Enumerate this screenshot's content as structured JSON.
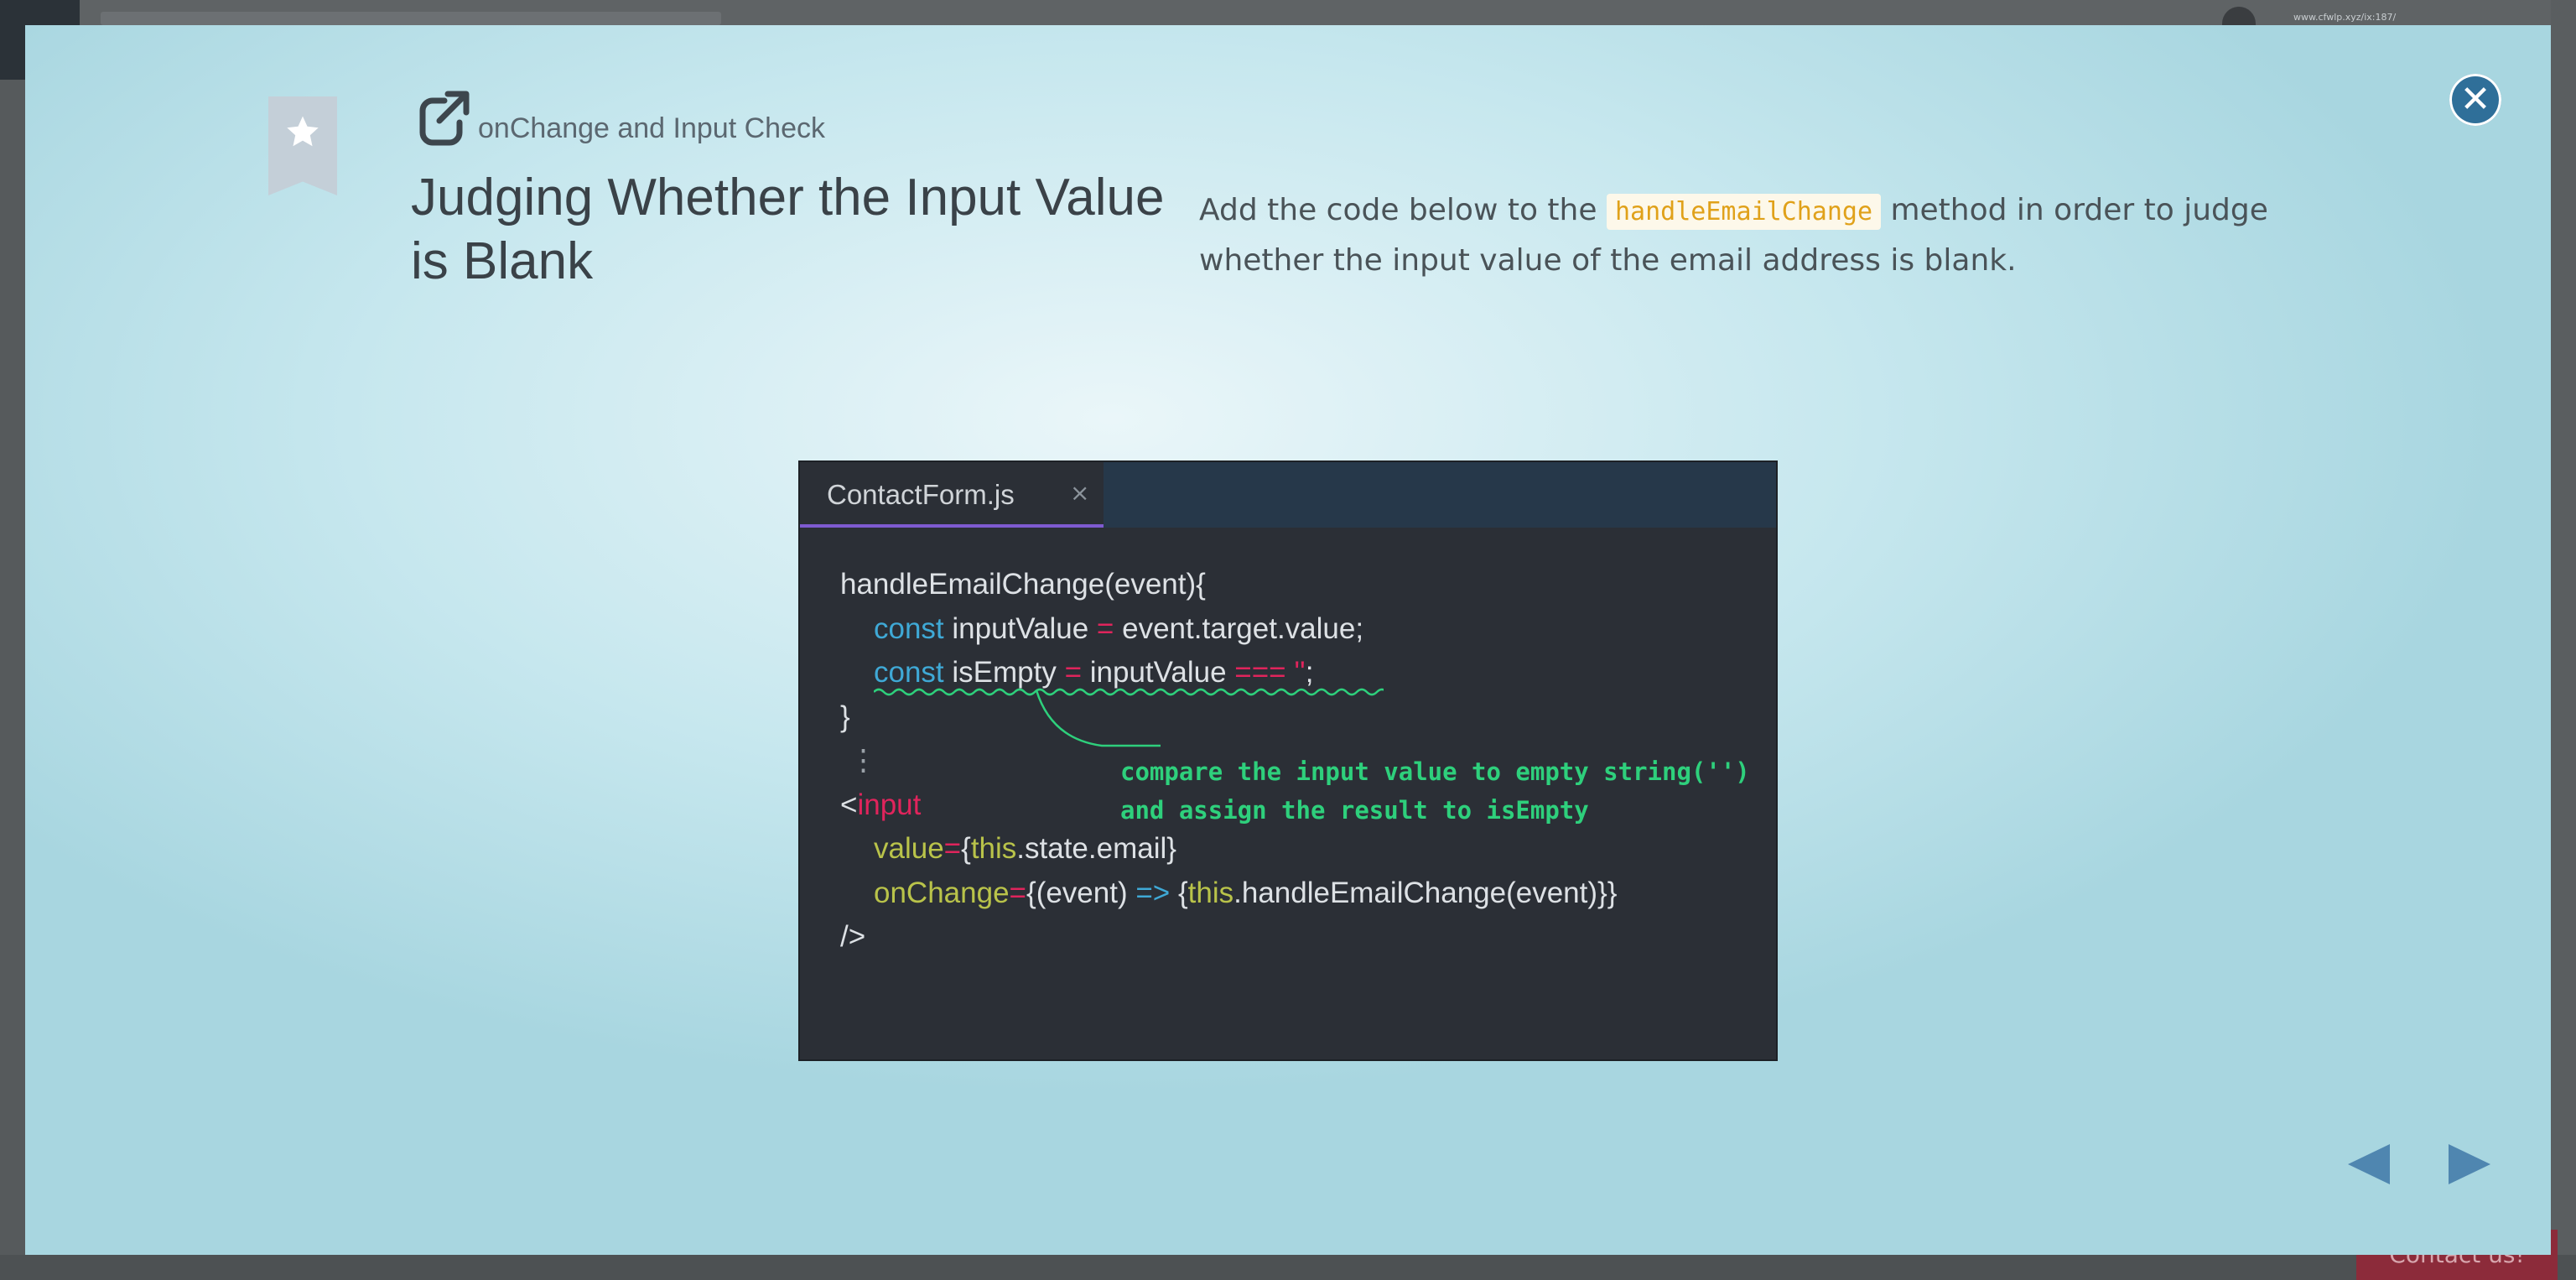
{
  "background": {
    "url_text": "www.cfwlp.xyz/ix:187/",
    "contact_label": "Contact us!"
  },
  "modal": {
    "subtitle": "onChange and Input Check",
    "title": "Judging Whether the Input Value is Blank",
    "description_before": "Add the code below to the ",
    "description_code": "handleEmailChange",
    "description_after": " method in order to judge whether the input value of the email address is blank.",
    "close_icon": "close-icon",
    "prev_icon": "triangle-left-icon",
    "next_icon": "triangle-right-icon",
    "bookmark_icon": "star-icon",
    "external_icon": "external-link-icon"
  },
  "code": {
    "tab_label": "ContactForm.js",
    "tab_close": "×",
    "line1": "handleEmailChange(event){",
    "line2_kw": "const",
    "line2_rest_a": " inputValue ",
    "line2_op": "=",
    "line2_rest_b": " event.target.value;",
    "line3_kw": "const",
    "line3_a": " isEmpty ",
    "line3_op": "=",
    "line3_b": " inputValue ",
    "line3_op2": "===",
    "line3_str": " ''",
    "line3_end": ";",
    "line4": "}",
    "line5": "⋮",
    "line6_lt": "<",
    "line6_tag": "input",
    "line7_attr": "value",
    "line7_eq": "=",
    "line7_b1": "{",
    "line7_this": "this",
    "line7_rest": ".state.email}",
    "line8_attr": "onChange",
    "line8_eq": "=",
    "line8_a": "{(event) ",
    "line8_arrow": "=>",
    "line8_b": " {",
    "line8_this": "this",
    "line8_rest": ".handleEmailChange(event)}}",
    "line9": "/>",
    "annotation_line1": "compare the input value to empty string('')",
    "annotation_line2": "and assign the result to isEmpty"
  }
}
